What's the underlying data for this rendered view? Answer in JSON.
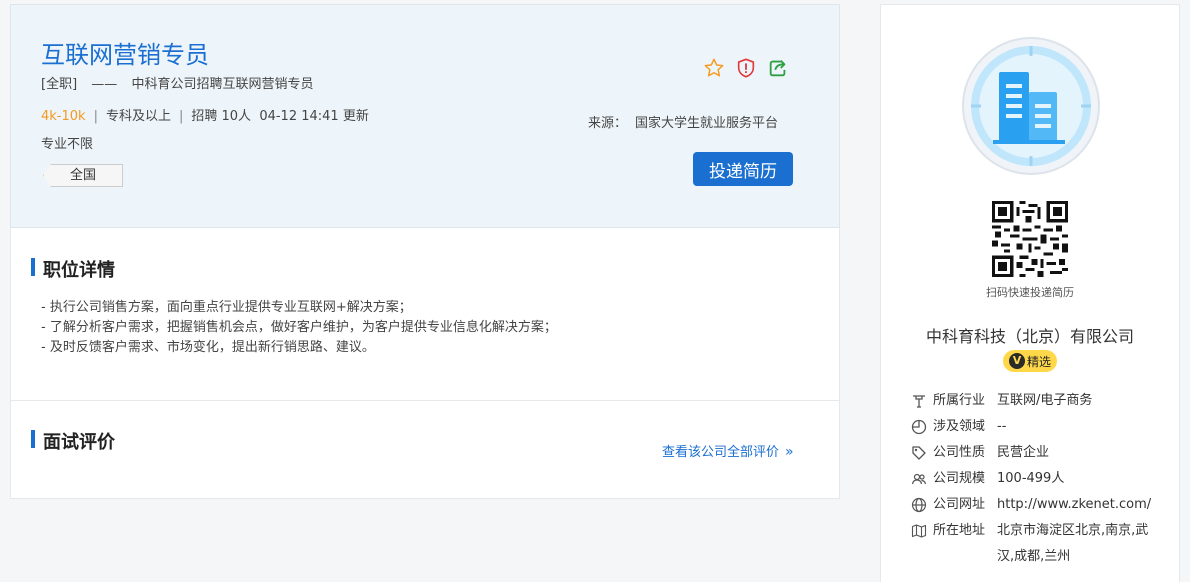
{
  "job": {
    "title": "互联网营销专员",
    "type": "[全职]",
    "dash": "——",
    "company_recruiting": "中科育公司招聘互联网营销专员",
    "salary": "4k-10k",
    "education": "专科及以上",
    "headcount": "招聘 10人",
    "updated": "04-12 14:41 更新",
    "major": "专业不限",
    "location_tag": "全国",
    "source_label": "来源：",
    "source_value": "国家大学生就业服务平台",
    "apply_button": "投递简历",
    "icons": [
      "star-icon",
      "shield-alert-icon",
      "share-icon"
    ]
  },
  "detail": {
    "title": "职位详情",
    "lines": [
      "- 执行公司销售方案，面向重点行业提供专业互联网+解决方案；",
      "- 了解分析客户需求，把握销售机会点，做好客户维护，为客户提供专业信息化解决方案；",
      "- 及时反馈客户需求、市场变化，提出新行销思路、建议。"
    ]
  },
  "review": {
    "title": "面试评价",
    "link": "查看该公司全部评价",
    "link_icon": "double-chevron-right-icon"
  },
  "company": {
    "qr_label": "扫码快速投递简历",
    "name": "中科育科技（北京）有限公司",
    "badge_letter": "V",
    "badge": "精选",
    "info": [
      {
        "icon": "industry-icon",
        "label": "所属行业",
        "value": "互联网/电子商务"
      },
      {
        "icon": "field-icon",
        "label": "涉及领域",
        "value": "--"
      },
      {
        "icon": "tag-icon",
        "label": "公司性质",
        "value": "民营企业"
      },
      {
        "icon": "people-icon",
        "label": "公司规模",
        "value": "100-499人"
      },
      {
        "icon": "globe-icon",
        "label": "公司网址",
        "value": "http://www.zkenet.com/"
      },
      {
        "icon": "map-icon",
        "label": "所在地址",
        "value": "北京市海淀区北京,南京,武汉,成都,兰州"
      }
    ]
  },
  "colors": {
    "accent": "#1a6fd1",
    "salary": "#f39a1f",
    "header_bg": "#eef5fa",
    "badge": "#ffd84a"
  }
}
